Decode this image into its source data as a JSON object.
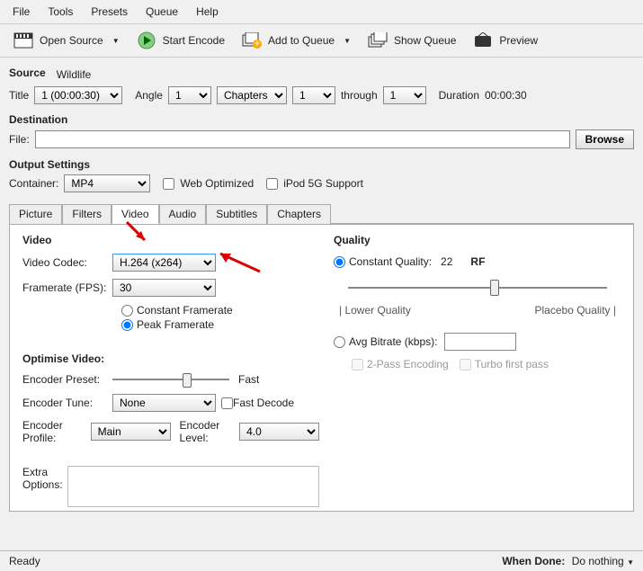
{
  "menu": {
    "file": "File",
    "tools": "Tools",
    "presets": "Presets",
    "queue": "Queue",
    "help": "Help"
  },
  "toolbar": {
    "open": "Open Source",
    "start": "Start Encode",
    "add": "Add to Queue",
    "show": "Show Queue",
    "preview": "Preview"
  },
  "source": {
    "label": "Source",
    "name": "Wildlife",
    "title_lbl": "Title",
    "title_val": "1 (00:00:30)",
    "angle_lbl": "Angle",
    "angle_val": "1",
    "chapters_lbl": "Chapters",
    "chap_from": "1",
    "through": "through",
    "chap_to": "1",
    "duration_lbl": "Duration",
    "duration_val": "00:00:30"
  },
  "destination": {
    "label": "Destination",
    "file_lbl": "File:",
    "file_val": "",
    "browse": "Browse"
  },
  "output": {
    "label": "Output Settings",
    "container_lbl": "Container:",
    "container_val": "MP4",
    "web_opt": "Web Optimized",
    "ipod": "iPod 5G Support"
  },
  "tabs": {
    "picture": "Picture",
    "filters": "Filters",
    "video": "Video",
    "audio": "Audio",
    "subtitles": "Subtitles",
    "chapters": "Chapters"
  },
  "video": {
    "section": "Video",
    "codec_lbl": "Video Codec:",
    "codec_val": "H.264 (x264)",
    "fps_lbl": "Framerate (FPS):",
    "fps_val": "30",
    "cfr": "Constant Framerate",
    "pfr": "Peak Framerate",
    "optimise": "Optimise Video:",
    "preset_lbl": "Encoder Preset:",
    "preset_val": "Fast",
    "tune_lbl": "Encoder Tune:",
    "tune_val": "None",
    "fast_decode": "Fast Decode",
    "profile_lbl": "Encoder Profile:",
    "profile_val": "Main",
    "level_lbl": "Encoder Level:",
    "level_val": "4.0",
    "extra_lbl": "Extra Options:"
  },
  "quality": {
    "label": "Quality",
    "cq": "Constant Quality:",
    "cq_val": "22",
    "rf": "RF",
    "lower": "| Lower Quality",
    "placebo": "Placebo Quality |",
    "avg": "Avg Bitrate (kbps):",
    "avg_val": "",
    "twopass": "2-Pass Encoding",
    "turbo": "Turbo first pass"
  },
  "status": {
    "ready": "Ready",
    "when_done_lbl": "When Done:",
    "when_done_val": "Do nothing"
  }
}
